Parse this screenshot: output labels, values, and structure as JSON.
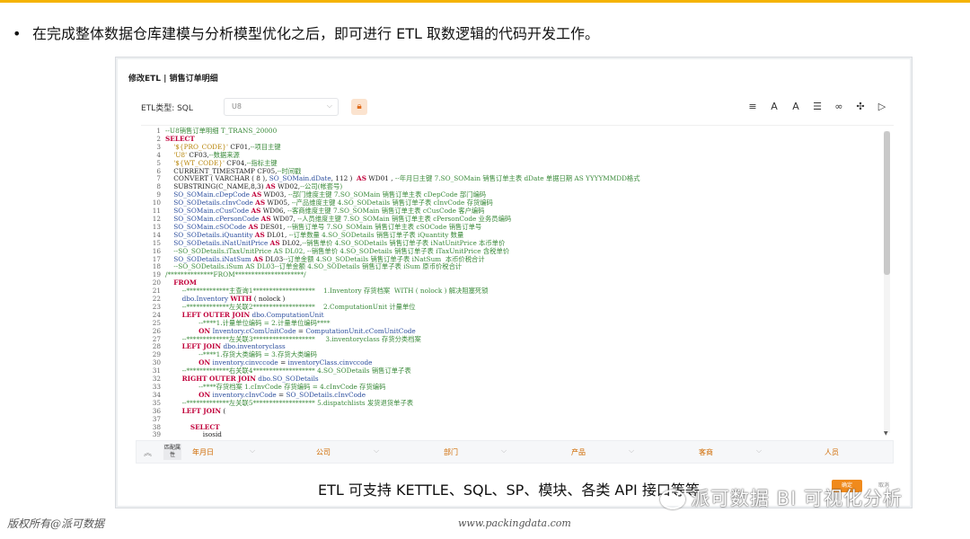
{
  "slide": {
    "bullet": "在完成整体数据仓库建模与分析模型优化之后，即可进行 ETL 取数逻辑的代码开发工作。",
    "caption": "ETL 可支持 KETTLE、SQL、SP、模块、各类 API 接口等等",
    "watermark": "派可数据 BI 可视化分析",
    "footer_left": "版权所有@派可数据",
    "footer_url": "www.packingdata.com",
    "accent_color": "#f5b301"
  },
  "dialog": {
    "title": "修改ETL | 销售订单明细",
    "etl_type_label": "ETL类型: SQL",
    "etl_select_value": "U8",
    "tools": [
      {
        "icon": "format-icon",
        "glyph": "≡"
      },
      {
        "icon": "font-decrease-icon",
        "glyph": "A"
      },
      {
        "icon": "font-increase-icon",
        "glyph": "A"
      },
      {
        "icon": "settings-icon",
        "glyph": "☰"
      },
      {
        "icon": "link-icon",
        "glyph": "∞"
      },
      {
        "icon": "debug-icon",
        "glyph": "✣"
      },
      {
        "icon": "run-icon",
        "glyph": "▷"
      }
    ],
    "confirm_label": "确定",
    "cancel_label": "取消"
  },
  "filters": {
    "match_label": "匹配属性",
    "items": [
      "年月日",
      "公司",
      "部门",
      "产品",
      "客商",
      "人员"
    ]
  },
  "code_lines": [
    "--U8销售订单明细 T_TRANS_20000",
    "SELECT",
    "    '${PRO_CODE}' CF01,--项目主键",
    "    'U8' CF03,--数据来源",
    "    '${WT_CODE}' CF04,--指标主键",
    "    CURRENT_TIMESTAMP CF05,--时间戳",
    "    CONVERT ( VARCHAR ( 8 ), SO_SOMain.dDate, 112 )  AS WD01 , --年月日主键 7.SO_SOMain 销售订单主表 dDate 单据日期 AS YYYYMMDD格式",
    "    SUBSTRING(C_NAME,8,3) AS WD02,--公司(帐套号)",
    "    SO_SOMain.cDepCode AS WD03, --部门维度主键 7.SO_SOMain 销售订单主表 cDepCode 部门编码",
    "    SO_SODetails.cInvCode AS WD05, --产品维度主键 4.SO_SODetails 销售订单子表 cInvCode 存货编码",
    "    SO_SOMain.cCusCode AS WD06, --客商维度主键 7.SO_SOMain 销售订单主表 cCusCode 客户编码",
    "    SO_SOMain.cPersonCode AS WD07, --人员维度主键 7.SO_SOMain 销售订单主表 cPersonCode 业务员编码",
    "    SO_SOMain.cSOCode AS DES01, --销售订单号 7.SO_SOMain 销售订单主表 cSOCode 销售订单号",
    "    SO_SODetails.iQuantity AS DL01, --订单数量 4.SO_SODetails 销售订单子表 iQuantity 数量",
    "    SO_SODetails.iNatUnitPrice AS DL02,--销售单价 4.SO_SODetails 销售订单子表 iNatUnitPrice 本币单价",
    "    --SO_SODetails.iTaxUnitPrice AS DL02, --销售单价 4.SO_SODetails 销售订单子表 iTaxUnitPrice 含税单价",
    "    SO_SODetails.iNatSum AS DL03--订单金额 4.SO_SODetails 销售订单子表 iNatSum  本币价税合计",
    "    --SO_SODetails.iSum AS DL03--订单金额 4.SO_SODetails 销售订单子表 iSum 原币价税合计",
    "/**************FROM*********************/",
    "    FROM",
    "        --*************主查询1*******************    1.Inventory 存货档案  WITH ( nolock ) 解决阻塞死锁",
    "        dbo.Inventory WITH ( nolock )",
    "        --*************左关联2*******************    2.ComputationUnit 计量单位",
    "        LEFT OUTER JOIN dbo.ComputationUnit",
    "                --****1.计量单位编码 = 2.计量单位编码****",
    "                ON Inventory.cComUnitCode = ComputationUnit.cComUnitCode",
    "        --*************左关联3*******************     3.inventoryclass 存货分类档案",
    "        LEFT JOIN dbo.inventoryclass",
    "                --****1.存货大类编码 = 3.存货大类编码",
    "                ON inventory.cinvccode = inventoryClass.cinvccode",
    "        --*************右关联4******************* 4.SO_SODetails 销售订单子表",
    "        RIGHT OUTER JOIN dbo.SO_SODetails",
    "                --****存货档案 1.cInvCode 存货编码 = 4.cInvCode 存货编码",
    "                ON inventory.cInvCode = SO_SODetails.cInvCode",
    "        --*************左关联5******************* 5.dispatchlists 发货退货单子表",
    "        LEFT JOIN (",
    "",
    "            SELECT",
    "                  isosid"
  ]
}
